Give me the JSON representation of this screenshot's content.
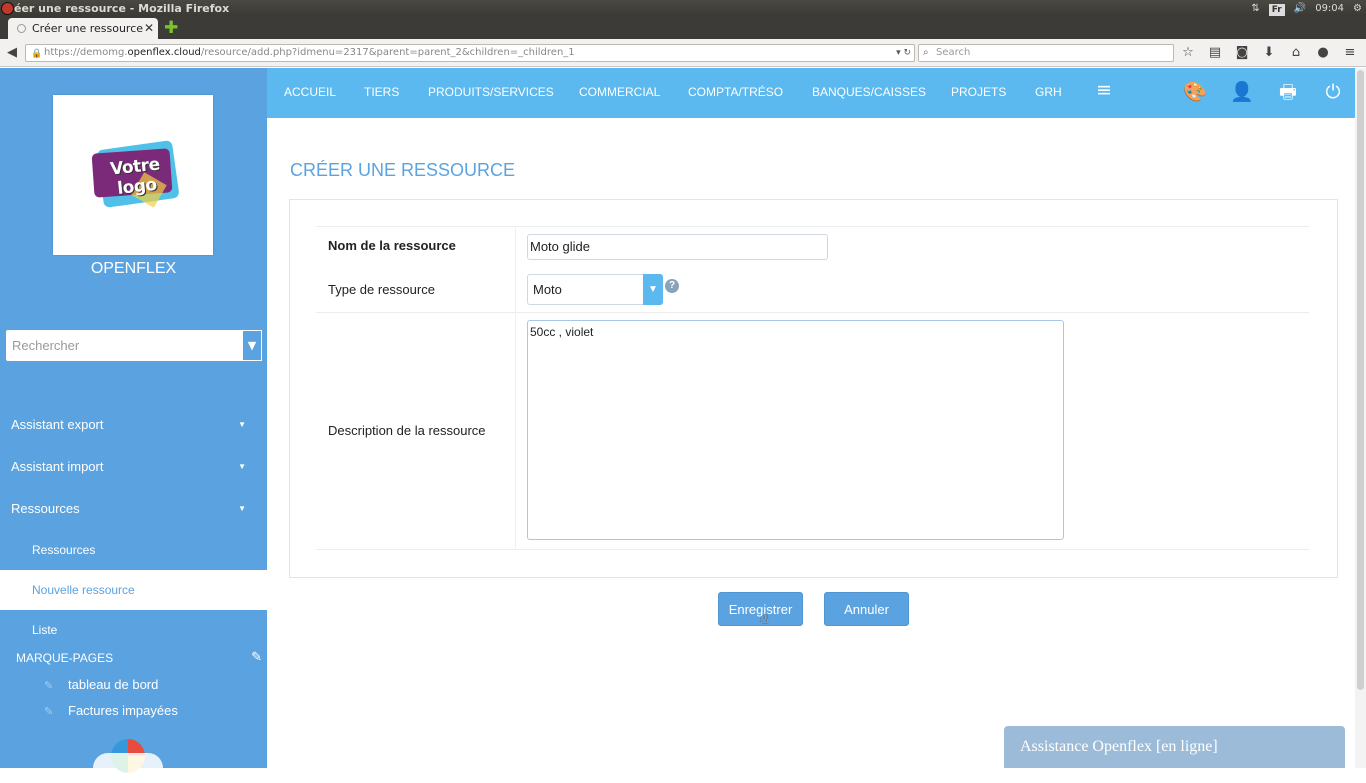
{
  "os": {
    "window_title": "éer une ressource - Mozilla Firefox",
    "keyboard_layout": "Fr",
    "clock": "09:04"
  },
  "browser": {
    "tab_title": "Créer une ressource",
    "url_prefix": "https://demomg.",
    "url_domain": "openflex.cloud",
    "url_path": "/resource/add.php?idmenu=2317&parent=parent_2&children=_children_1",
    "search_placeholder": "Search",
    "toolbar_icons": [
      "star-icon",
      "reading-list-icon",
      "pocket-icon",
      "download-icon",
      "home-icon",
      "chat-icon",
      "menu-icon"
    ]
  },
  "sidebar": {
    "logo_text": "Votre logo",
    "company_name": "OPENFLEX",
    "search_placeholder": "Rechercher",
    "groups": [
      {
        "label": "Assistant export"
      },
      {
        "label": "Assistant import"
      },
      {
        "label": "Ressources"
      }
    ],
    "sub_items": [
      {
        "label": "Ressources",
        "active": false
      },
      {
        "label": "Nouvelle ressource",
        "active": true
      },
      {
        "label": "Liste",
        "active": false
      }
    ],
    "bookmarks_title": "MARQUE-PAGES",
    "bookmarks": [
      {
        "label": "tableau de bord"
      },
      {
        "label": "Factures impayées"
      }
    ]
  },
  "topnav": {
    "items": [
      "ACCUEIL",
      "TIERS",
      "PRODUITS/SERVICES",
      "COMMERCIAL",
      "COMPTA/TRÉSO",
      "BANQUES/CAISSES",
      "PROJETS",
      "GRH"
    ],
    "icons": [
      "hamburger-menu-icon",
      "theme-palette-icon",
      "user-icon",
      "print-icon",
      "power-icon"
    ]
  },
  "form": {
    "title": "CRÉER UNE RESSOURCE",
    "name_label": "Nom de la ressource",
    "name_value": "Moto glide",
    "type_label": "Type de ressource",
    "type_value": "Moto",
    "description_label": "Description de la ressource",
    "description_value": "50cc , violet",
    "save_label": "Enregistrer",
    "cancel_label": "Annuler"
  },
  "chat": {
    "label": "Assistance Openflex [en ligne]"
  },
  "colors": {
    "sidebar": "#5ba3e0",
    "topbar": "#5bb9f0",
    "title": "#5ba3e0"
  }
}
